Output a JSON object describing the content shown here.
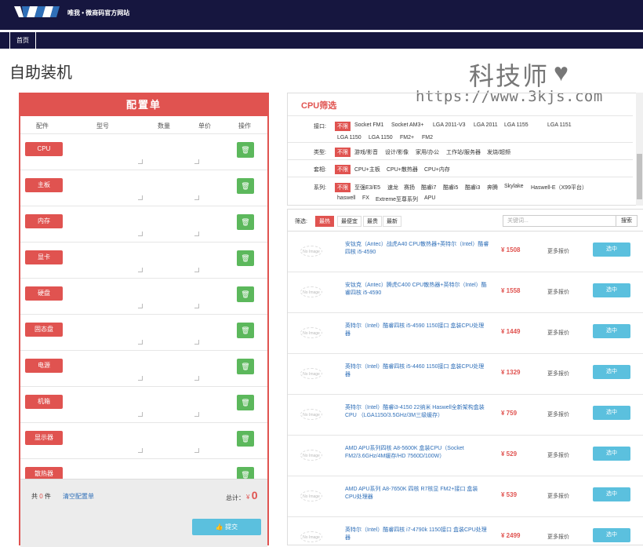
{
  "header": {
    "site_title": "唯我 • 微商码官方网站",
    "nav": [
      "首页"
    ]
  },
  "page_title": "自助装机",
  "watermark": {
    "text": "科技师",
    "url": "https://www.3kjs.com"
  },
  "config": {
    "title": "配置单",
    "columns": [
      "配件",
      "型号",
      "数量",
      "单价",
      "操作"
    ],
    "parts": [
      "CPU",
      "主板",
      "内存",
      "显卡",
      "硬盘",
      "固态盘",
      "电源",
      "机箱",
      "显示器",
      "散热器"
    ],
    "count_prefix": "共",
    "count": "0",
    "count_suffix": "件",
    "clear_label": "清空配置单",
    "total_label": "总计：",
    "total_currency": "¥",
    "total_value": "0",
    "submit_label": "提交"
  },
  "filter": {
    "title": "CPU筛选",
    "groups": [
      {
        "label": "接口:",
        "options": [
          "不限",
          "Socket FM1",
          "Socket AM3+",
          "LGA 2011-V3",
          "LGA 2011",
          "LGA 1155",
          "LGA 1151",
          "LGA 1150",
          "LGA 1150",
          "FM2+",
          "FM2"
        ]
      },
      {
        "label": "类型:",
        "options": [
          "不限",
          "游戏/影音",
          "设计/影像",
          "家用/办公",
          "工作站/服务器",
          "发烧/超频"
        ]
      },
      {
        "label": "套相:",
        "options": [
          "不限",
          "CPU+主板",
          "CPU+散热器",
          "CPU+内存"
        ]
      },
      {
        "label": "系列:",
        "options": [
          "不限",
          "至强E3/E5",
          "速龙",
          "赛扬",
          "酷睿i7",
          "酷睿i5",
          "酷睿i3",
          "奔腾",
          "Skylake",
          "Haswell-E（X99平台）",
          "haswell",
          "FX",
          "Extreme至尊系列",
          "APU"
        ]
      }
    ]
  },
  "results": {
    "sort_label": "筛选:",
    "sort_tabs": [
      "最热",
      "最便宜",
      "最贵",
      "最新"
    ],
    "search_placeholder": "关键词...",
    "search_button": "搜索",
    "no_image_text": "No Image",
    "more_label": "更多报价",
    "select_label": "选中",
    "products": [
      {
        "name": "安钛克（Antec）战虎A40 CPU散热器+英特尔（Intel）酷睿四核 i5-4590",
        "price": "¥ 1508"
      },
      {
        "name": "安钛克（Antec）腾虎C400 CPU散热器+英特尔（Intel）酷睿四核 i5-4590",
        "price": "¥ 1558"
      },
      {
        "name": "英特尔（Intel）酷睿四核 i5-4590 1150接口 盒装CPU处理器",
        "price": "¥ 1449"
      },
      {
        "name": "英特尔（Intel）酷睿四核 i5-4460 1150接口 盒装CPU处理器",
        "price": "¥ 1329"
      },
      {
        "name": "英特尔（Intel）酷睿i3-4150 22纳米 Haswell全新架构盒装CPU （LGA1150/3.5GHz/3M三级缓存）",
        "price": "¥ 759"
      },
      {
        "name": "AMD APU系列四核 A8-5600K 盒装CPU（Socket FM2/3.6GHz/4M缓存/HD 7560D/100W）",
        "price": "¥ 529"
      },
      {
        "name": "AMD APU系列 A8-7650K 四核 R7核显 FM2+接口 盒装CPU处理器",
        "price": "¥ 539"
      },
      {
        "name": "英特尔（Intel）酷睿四核 i7-4790k 1150接口 盒装CPU处理器",
        "price": "¥ 2499"
      }
    ]
  },
  "colors": {
    "accent_red": "#e05350",
    "navy": "#16163f",
    "green": "#5cb85c",
    "blue": "#5bc0de"
  },
  "icons": {
    "delete": "trash-icon",
    "submit": "thumbs-up-icon",
    "watermark": "heart-icon"
  }
}
